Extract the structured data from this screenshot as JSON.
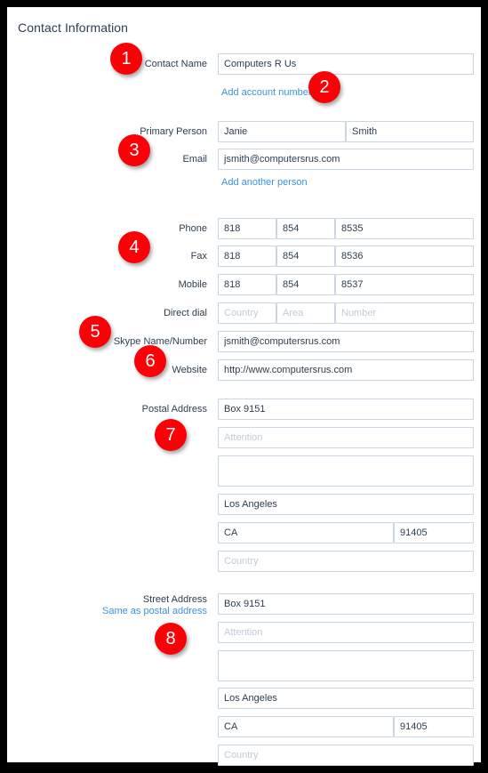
{
  "page": {
    "title": "Contact Information",
    "accent_red": "#fb0007",
    "link_blue": "#3b93e0",
    "text_color": "#2d3e50",
    "field_border": "#c9d6e3",
    "frame_color": "#000000"
  },
  "fields": {
    "contact_name": {
      "label": "Contact Name",
      "value": "Computers R Us"
    },
    "add_account_number_link": "Add account number",
    "primary_person": {
      "label": "Primary Person",
      "first_name": "Janie",
      "last_name": "Smith"
    },
    "email": {
      "label": "Email",
      "value": "jsmith@computersrus.com"
    },
    "add_another_person_link": "Add another person",
    "phone": {
      "label": "Phone",
      "country": "818",
      "area": "854",
      "number": "8535"
    },
    "fax": {
      "label": "Fax",
      "country": "818",
      "area": "854",
      "number": "8536"
    },
    "mobile": {
      "label": "Mobile",
      "country": "818",
      "area": "854",
      "number": "8537"
    },
    "direct_dial": {
      "label": "Direct dial",
      "country": "",
      "area": "",
      "number": "",
      "country_placeholder": "Country",
      "area_placeholder": "Area",
      "number_placeholder": "Number"
    },
    "skype": {
      "label": "Skype Name/Number",
      "value": "jsmith@computersrus.com"
    },
    "website": {
      "label": "Website",
      "value": "http://www.computersrus.com"
    },
    "postal_address": {
      "label": "Postal Address",
      "line1": "Box 9151",
      "attention": "",
      "attention_placeholder": "Attention",
      "extra": "",
      "city": "Los Angeles",
      "state": "CA",
      "zip": "91405",
      "country": "",
      "country_placeholder": "Country"
    },
    "street_address": {
      "label": "Street Address",
      "same_as_postal_link": "Same as postal address",
      "line1": "Box 9151",
      "attention": "",
      "attention_placeholder": "Attention",
      "extra": "",
      "city": "Los Angeles",
      "state": "CA",
      "zip": "91405",
      "country": "",
      "country_placeholder": "Country"
    }
  },
  "badges": [
    {
      "number": "1",
      "target": "contact-name"
    },
    {
      "number": "2",
      "target": "add-account-number"
    },
    {
      "number": "3",
      "target": "email"
    },
    {
      "number": "4",
      "target": "phone-group"
    },
    {
      "number": "5",
      "target": "skype"
    },
    {
      "number": "6",
      "target": "website"
    },
    {
      "number": "7",
      "target": "postal-address"
    },
    {
      "number": "8",
      "target": "street-address"
    }
  ]
}
